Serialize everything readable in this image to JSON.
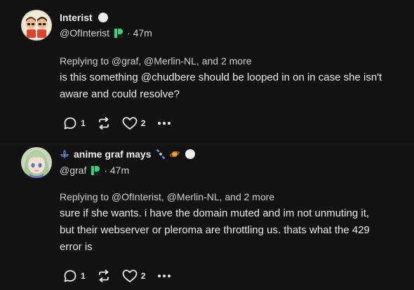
{
  "posts": [
    {
      "author": {
        "display_name": "Interist",
        "handle": "@OfInterist",
        "avatar_icon": "cartoon-couple-avatar",
        "badge_icon": "verified-dot"
      },
      "time": "· 47m",
      "replying_to": "Replying to @graf, @Merlin-NL, and 2 more",
      "body_lines": [
        "is this something @chudbere should be looped in on in case she isn't",
        "aware and could resolve?"
      ],
      "actions": {
        "replies": "1",
        "likes": "2"
      }
    },
    {
      "author": {
        "display_name": "anime graf mays",
        "handle": "@graf",
        "avatar_icon": "anime-girl-avatar",
        "badge_icon": "verified-dot",
        "name_emojis": [
          "blue-flower-icon",
          "satellite-icon",
          "ringed-planet-icon"
        ]
      },
      "time": "· 47m",
      "replying_to": "Replying to @OfInterist, @Merlin-NL, and 2 more",
      "body_lines": [
        "sure if she wants. i have the domain muted and im not unmuting it,",
        "but their webserver or pleroma are throttling us. thats what the 429",
        "error is"
      ],
      "actions": {
        "replies": "1",
        "likes": "2"
      }
    }
  ]
}
